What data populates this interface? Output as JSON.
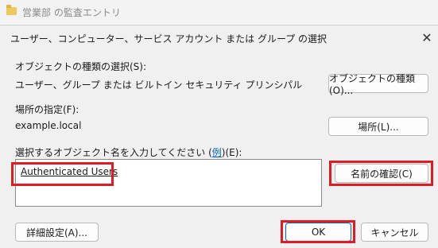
{
  "background_window": {
    "title": "営業部 の監査エントリ"
  },
  "dialog": {
    "title": "ユーザー、コンピューター、サービス アカウント または グループ の選択",
    "object_types": {
      "label": "オブジェクトの種類の選択(S):",
      "value": "ユーザー、グループ または ビルトイン セキュリティ プリンシパル",
      "button": "オブジェクトの種類(O)..."
    },
    "location": {
      "label": "場所の指定(F):",
      "value": "example.local",
      "button": "場所(L)..."
    },
    "object_names": {
      "label_pre": "選択するオブジェクト名を入力してください (",
      "label_link": "例",
      "label_post": ")(E):",
      "entry": "Authenticated Users",
      "check_button": "名前の確認(C)"
    },
    "buttons": {
      "advanced": "詳細設定(A)...",
      "ok": "OK",
      "cancel": "キャンセル"
    }
  },
  "colors": {
    "highlight": "#e01b24",
    "accent": "#0067c0"
  },
  "icons": {
    "folder": "folder-icon",
    "close": "close-icon"
  }
}
